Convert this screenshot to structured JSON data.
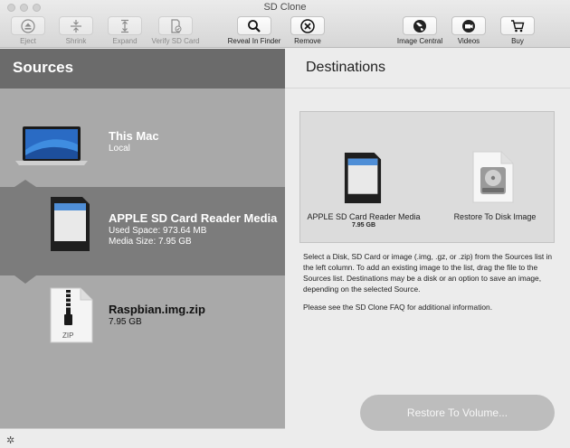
{
  "window": {
    "title": "SD Clone"
  },
  "toolbar": {
    "eject": "Eject",
    "shrink": "Shrink",
    "expand": "Expand",
    "verify": "Verify SD Card",
    "reveal": "Reveal In Finder",
    "remove": "Remove",
    "image_central": "Image Central",
    "videos": "Videos",
    "buy": "Buy"
  },
  "sources": {
    "title": "Sources",
    "items": [
      {
        "title": "This Mac",
        "sub1": "Local",
        "sub2": ""
      },
      {
        "title": "APPLE SD Card Reader Media",
        "sub1": "Used Space: 973.64 MB",
        "sub2": "Media Size: 7.95 GB"
      },
      {
        "title": "Raspbian.img.zip",
        "sub1": "7.95 GB",
        "sub2": "",
        "icon_label": "ZIP"
      }
    ]
  },
  "destinations": {
    "title": "Destinations",
    "items": [
      {
        "label": "APPLE SD Card Reader Media",
        "size": "7.95 GB"
      },
      {
        "label": "Restore To Disk Image"
      }
    ],
    "description1": "Select a Disk, SD Card or image (.img, .gz, or .zip) from the Sources list in the left column.  To add an existing image to the list, drag the file to the Sources list.  Destinations may be a disk or an option to save an image, depending on the selected Source.",
    "description2": "Please see the SD Clone FAQ for additional information.",
    "restore_button": "Restore To Volume..."
  },
  "icons": {
    "settings": "gear-icon"
  }
}
